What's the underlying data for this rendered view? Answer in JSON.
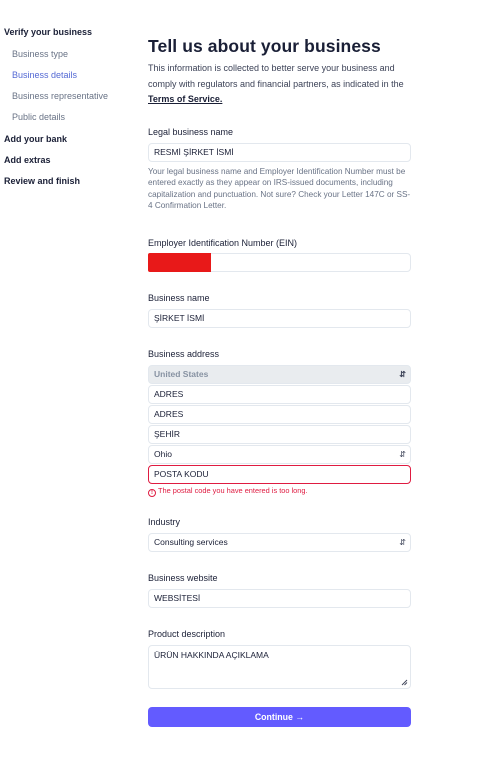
{
  "sidebar": {
    "sections": [
      {
        "label": "Verify your business"
      },
      {
        "label": "Add your bank"
      },
      {
        "label": "Add extras"
      },
      {
        "label": "Review and finish"
      }
    ],
    "subitems": [
      {
        "label": "Business type"
      },
      {
        "label": "Business details"
      },
      {
        "label": "Business representative"
      },
      {
        "label": "Public details"
      }
    ],
    "active_subitem": "Business details"
  },
  "header": {
    "title": "Tell us about your business",
    "intro_text": "This information is collected to better serve your business and comply with regulators and financial partners, as indicated in the ",
    "tos_link": "Terms of Service."
  },
  "form": {
    "legal_name": {
      "label": "Legal business name",
      "value": "RESMİ ŞİRKET İSMİ",
      "help": "Your legal business name and Employer Identification Number must be entered exactly as they appear on IRS-issued documents, including capitalization and punctuation. Not sure? Check your Letter 147C or SS-4 Confirmation Letter."
    },
    "ein": {
      "label": "Employer Identification Number (EIN)",
      "value": ""
    },
    "business_name": {
      "label": "Business name",
      "value": "ŞİRKET İSMİ"
    },
    "address": {
      "label": "Business address",
      "country": "United States",
      "line1": "ADRES",
      "line2": "ADRES",
      "city": "ŞEHİR",
      "state": "Ohio",
      "postal_code": "POSTA KODU",
      "postal_error": "The postal code you have entered is too long."
    },
    "industry": {
      "label": "Industry",
      "value": "Consulting services"
    },
    "website": {
      "label": "Business website",
      "value": "WEBSİTESİ"
    },
    "product_description": {
      "label": "Product description",
      "value": "ÜRÜN HAKKINDA AÇIKLAMA"
    }
  },
  "continue_button": {
    "label": "Continue →"
  },
  "colors": {
    "accent": "#635bff",
    "active_nav": "#5469d4",
    "error": "#df1b41",
    "redaction": "#e81919"
  }
}
